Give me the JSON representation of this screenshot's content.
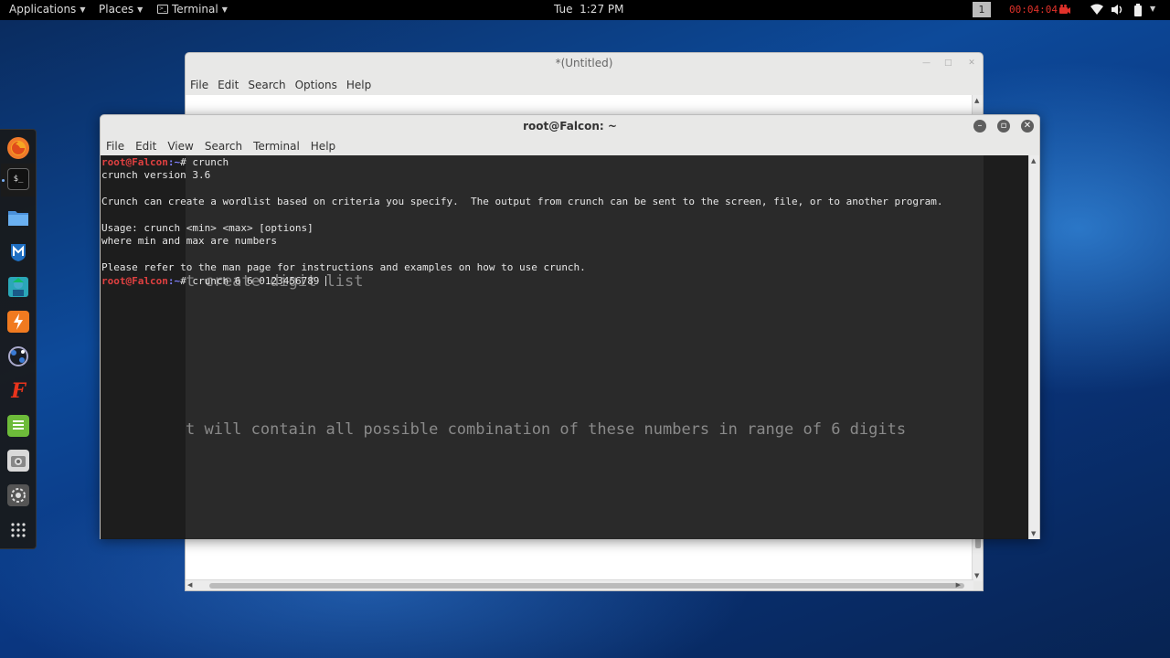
{
  "topbar": {
    "applications": "Applications",
    "places": "Places",
    "terminal": "Terminal",
    "clock": "Tue  1:27 PM",
    "workspace": "1",
    "recording_time": "00:04:04",
    "icons": [
      "camera-icon",
      "wifi-icon",
      "volume-icon",
      "battery-icon"
    ]
  },
  "dock": {
    "items": [
      "firefox-icon",
      "terminal-icon",
      "files-icon",
      "metasploit-icon",
      "armitage-icon",
      "burpsuite-icon",
      "maltego-icon",
      "faraday-icon",
      "leafpad-icon",
      "screenshot-icon",
      "settings-icon",
      "show-apps-icon"
    ]
  },
  "gedit": {
    "title": "*(Untitled)",
    "menu": [
      "File",
      "Edit",
      "Search",
      "Options",
      "Help"
    ],
    "line1": "t create digit list",
    "line2": "t will contain all possible combination of these numbers in range of 6 digits"
  },
  "terminal": {
    "title": "root@Falcon: ~",
    "menu": [
      "File",
      "Edit",
      "View",
      "Search",
      "Terminal",
      "Help"
    ],
    "prompt_user": "root@Falcon",
    "prompt_sep": ":~",
    "prompt_hash": "# ",
    "cmd1": "crunch",
    "out1": "crunch version 3.6",
    "out2": "Crunch can create a wordlist based on criteria you specify.  The output from crunch can be sent to the screen, file, or to another program.",
    "out3": "Usage: crunch <min> <max> [options]",
    "out4": "where min and max are numbers",
    "out5": "Please refer to the man page for instructions and examples on how to use crunch.",
    "cmd2": "crunch 6 6 0123456789 "
  },
  "colors": {
    "prompt_user": "#e04040",
    "prompt_path": "#8080ff",
    "recording": "#e0312a"
  }
}
